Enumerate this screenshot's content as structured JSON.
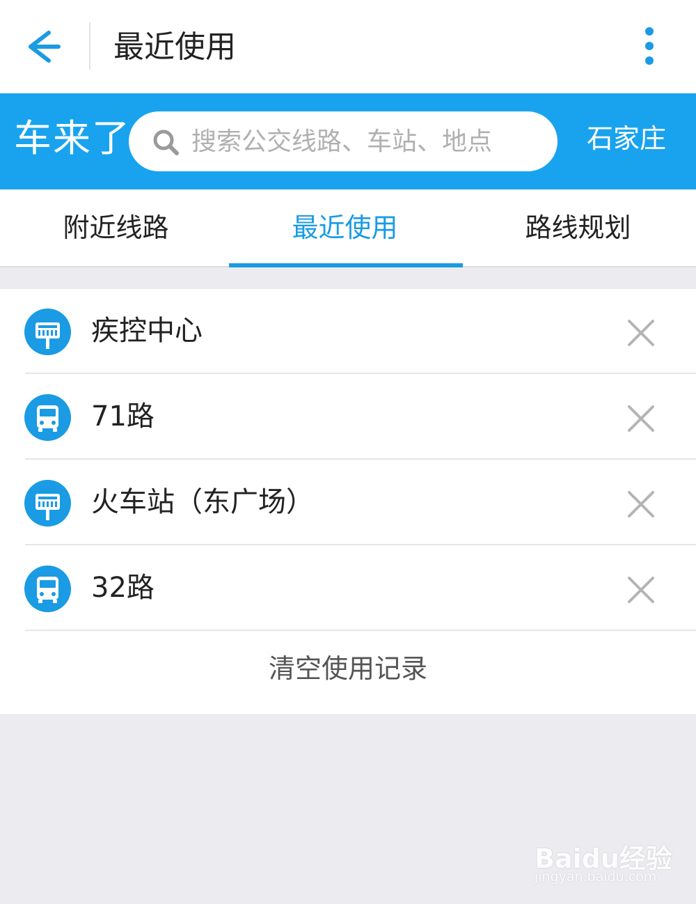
{
  "header": {
    "title": "最近使用"
  },
  "search_band": {
    "brand": "车来了",
    "search_placeholder": "搜索公交线路、车站、地点",
    "city": "石家庄"
  },
  "tabs": [
    {
      "label": "附近线路",
      "active": false
    },
    {
      "label": "最近使用",
      "active": true
    },
    {
      "label": "路线规划",
      "active": false
    }
  ],
  "recent_items": [
    {
      "label": "疾控中心",
      "type": "stop",
      "icon": "bus-stop-icon"
    },
    {
      "label": "71路",
      "type": "line",
      "icon": "bus-icon"
    },
    {
      "label": "火车站（东广场）",
      "type": "stop",
      "icon": "bus-stop-icon"
    },
    {
      "label": "32路",
      "type": "line",
      "icon": "bus-icon"
    }
  ],
  "clear_label": "清空使用记录",
  "watermark": {
    "main": "Baidu经验",
    "sub": "jingyan.baidu.com"
  },
  "colors": {
    "accent": "#1a9be3",
    "band": "#19a3ee",
    "background": "#ececf0"
  }
}
